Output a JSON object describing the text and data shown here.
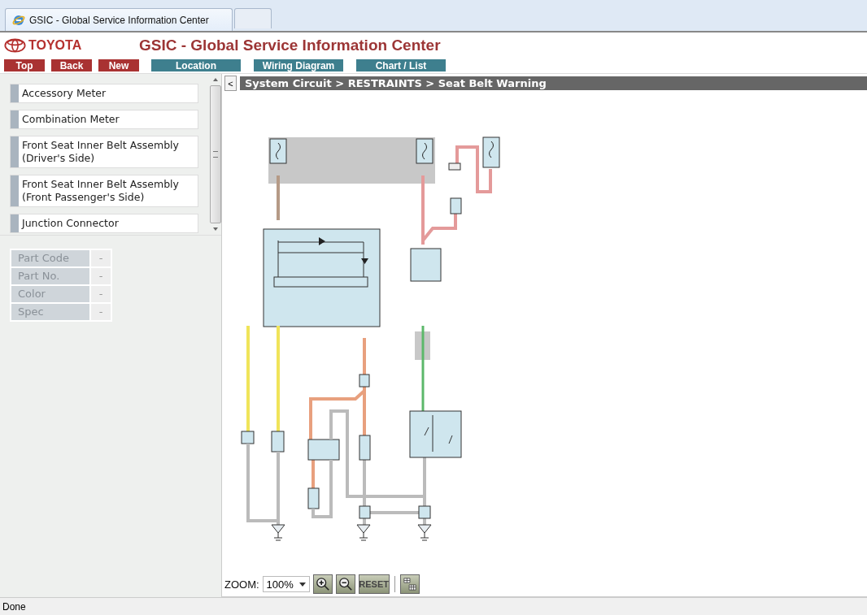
{
  "browser_tabs": [
    {
      "title": "GSIC - Global Service Information Center",
      "selected": true
    },
    {
      "selected": false
    }
  ],
  "header": {
    "brand": "TOYOTA",
    "title": "GSIC - Global Service Information Center"
  },
  "nav_buttons": [
    {
      "label": "Top",
      "kind": "red"
    },
    {
      "label": "Back",
      "kind": "red"
    },
    {
      "label": "New",
      "kind": "red"
    },
    {
      "label": "Location",
      "kind": "teal"
    },
    {
      "label": "Wiring Diagram",
      "kind": "teal"
    },
    {
      "label": "Chart / List",
      "kind": "teal"
    }
  ],
  "parts_list": [
    {
      "label": "Accessory Meter"
    },
    {
      "label": "Combination Meter"
    },
    {
      "label": "Front Seat Inner Belt Assembly (Driver's Side)"
    },
    {
      "label": "Front Seat Inner Belt Assembly (Front Passenger's Side)"
    },
    {
      "label": "Junction Connector"
    }
  ],
  "details": [
    {
      "label": "Part Code",
      "value": "-"
    },
    {
      "label": "Part No.",
      "value": "-"
    },
    {
      "label": "Color",
      "value": "-"
    },
    {
      "label": "Spec",
      "value": "-"
    }
  ],
  "collapse_button": "<",
  "breadcrumb": "System Circuit > RESTRAINTS > Seat Belt Warning",
  "zoom": {
    "label": "ZOOM:",
    "value": "100%",
    "reset": "RESET"
  },
  "status_bar": "Done"
}
